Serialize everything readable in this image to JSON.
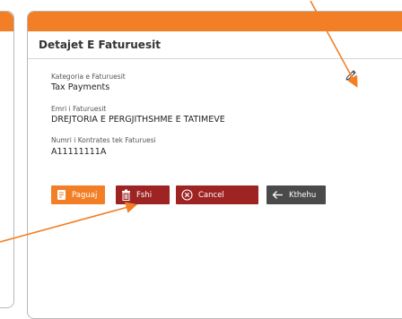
{
  "detail": {
    "title": "Detajet E Faturuesit",
    "fields": [
      {
        "label": "Kategoria e Faturuesit",
        "value": "Tax Payments"
      },
      {
        "label": "Emri i Faturuesit",
        "value": "DREJTORIA E PERGJITHSHME E TATIMEVE"
      },
      {
        "label": "Numri i Kontrates tek Faturuesi",
        "value": "A11111111A"
      }
    ]
  },
  "buttons": {
    "pay": "Paguaj",
    "delete": "Fshi",
    "cancel": "Cancel",
    "back": "Kthehu"
  },
  "colors": {
    "accent": "#f27f26",
    "danger": "#9e2424",
    "dark": "#4a4a4a"
  },
  "icons": [
    "pencil-icon",
    "bill-icon",
    "trash-icon",
    "close-circle-icon",
    "arrow-left-icon"
  ]
}
